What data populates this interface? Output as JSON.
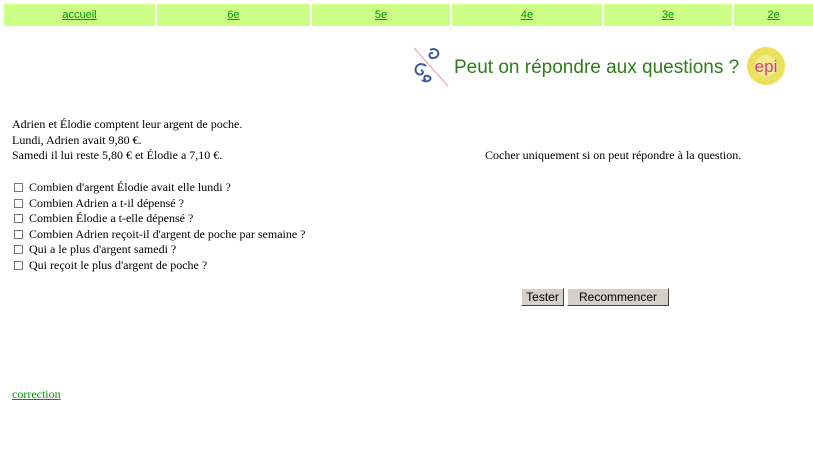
{
  "nav": {
    "items": [
      {
        "label": "accueil"
      },
      {
        "label": "6e"
      },
      {
        "label": "5e"
      },
      {
        "label": "4e"
      },
      {
        "label": "3e"
      },
      {
        "label": "2e"
      }
    ]
  },
  "banner": {
    "title": "Peut on répondre aux questions ?",
    "logo_text": "epi"
  },
  "problem": {
    "lines": [
      "Adrien et Élodie comptent leur argent de poche.",
      "Lundi, Adrien avait 9,80 €.",
      "Samedi il lui reste 5,80 € et Élodie a 7,10 €."
    ]
  },
  "instruction": "Cocher uniquement si on peut répondre à la question.",
  "questions": [
    {
      "label": "Combien d'argent Élodie avait elle lundi ?",
      "checked": false
    },
    {
      "label": "Combien Adrien a t-il dépensé ?",
      "checked": false
    },
    {
      "label": "Combien Élodie a t-elle dépensé ?",
      "checked": false
    },
    {
      "label": "Combien Adrien reçoit-il d'argent de poche par semaine ?",
      "checked": false
    },
    {
      "label": "Qui a le plus d'argent samedi ?",
      "checked": false
    },
    {
      "label": "Qui reçoit le plus d'argent de poche ?",
      "checked": false
    }
  ],
  "buttons": {
    "test_label": "Tester",
    "reset_label": "Recommencer"
  },
  "correction_link": "correction",
  "colors": {
    "nav_bg": "#ccff88",
    "link": "#009900",
    "title": "#2e7d18"
  }
}
